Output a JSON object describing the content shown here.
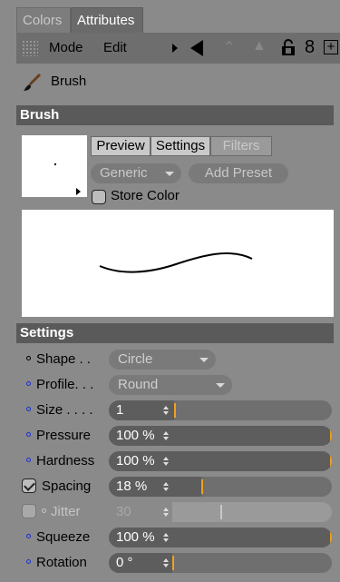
{
  "tabs": {
    "colors": "Colors",
    "attributes": "Attributes"
  },
  "toolbar": {
    "mode": "Mode",
    "edit": "Edit",
    "lock_icon": "lock-icon",
    "number_icon": "8"
  },
  "object": {
    "name": "Brush"
  },
  "brush_section": {
    "title": "Brush",
    "tabs": [
      "Preview",
      "Settings",
      "Filters"
    ],
    "preset_combo": "Generic",
    "add_preset": "Add Preset",
    "store_color": "Store Color"
  },
  "settings_section": {
    "title": "Settings",
    "rows": [
      {
        "label": "Shape . .",
        "type": "combo",
        "value": "Circle"
      },
      {
        "label": "Profile. . .",
        "type": "combo",
        "value": "Round"
      },
      {
        "label": "Size . . . .",
        "type": "number",
        "value": "1",
        "fraction": 0.01
      },
      {
        "label": "Pressure",
        "type": "number",
        "value": "100 %",
        "fraction": 1.0
      },
      {
        "label": "Hardness",
        "type": "number",
        "value": "100 %",
        "fraction": 1.0
      },
      {
        "label": "Spacing",
        "type": "number",
        "value": "18 %",
        "fraction": 0.18
      },
      {
        "label": "Jitter",
        "type": "number",
        "value": "30",
        "fraction": 0.3
      },
      {
        "label": "Squeeze",
        "type": "number",
        "value": "100 %",
        "fraction": 1.0
      },
      {
        "label": "Rotation",
        "type": "number",
        "value": "0 °",
        "fraction": 0.0
      }
    ]
  },
  "colors": {
    "accent_marker": "#f0a020",
    "param_dot": "#1a2fd0",
    "section_header": "#5a5a5a"
  }
}
